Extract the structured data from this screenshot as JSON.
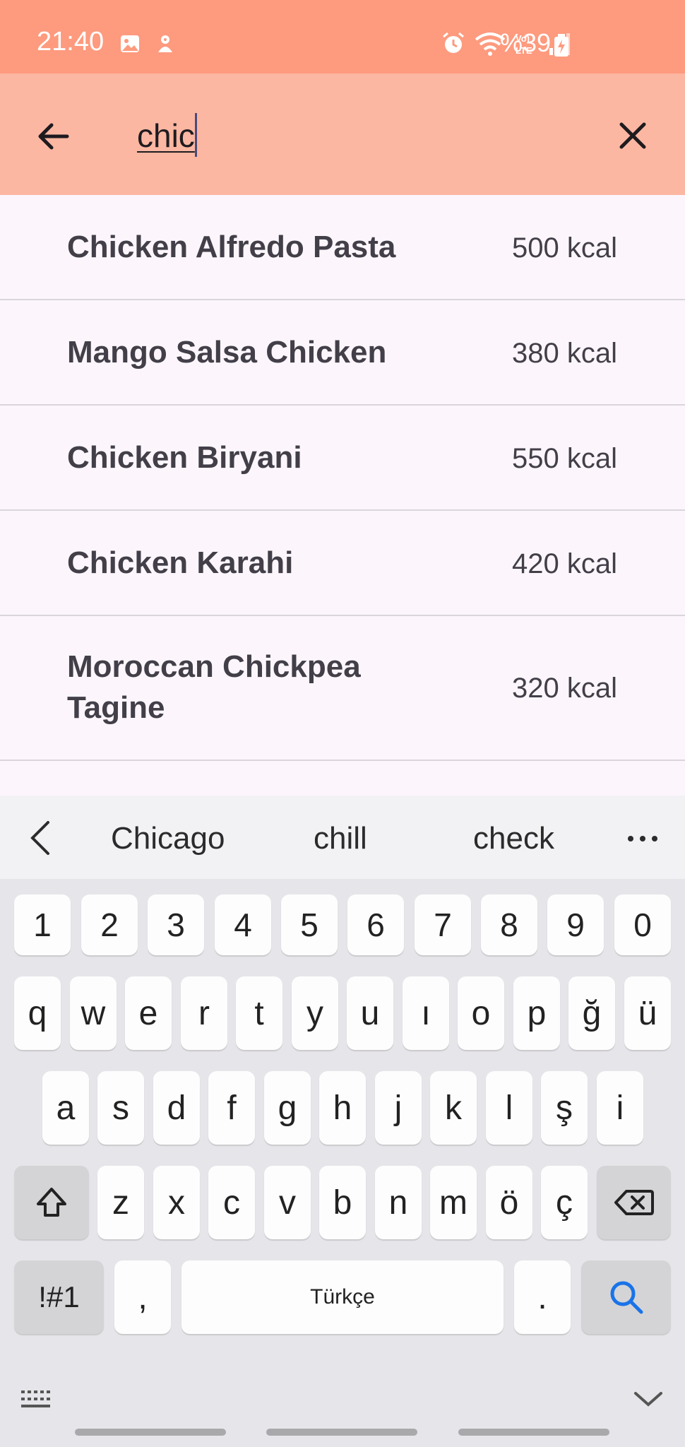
{
  "status_bar": {
    "time": "21:40",
    "battery": "%39",
    "icons": [
      "image-icon",
      "notification-icon",
      "alarm-icon",
      "wifi-icon",
      "volte-icon",
      "signal-icon",
      "battery-charging-icon"
    ]
  },
  "search": {
    "query": "chic",
    "back_icon": "arrow-left-icon",
    "clear_icon": "close-icon"
  },
  "results": [
    {
      "name": "Chicken Alfredo Pasta",
      "kcal": "500 kcal"
    },
    {
      "name": "Mango Salsa Chicken",
      "kcal": "380 kcal"
    },
    {
      "name": "Chicken Biryani",
      "kcal": "550 kcal"
    },
    {
      "name": "Chicken Karahi",
      "kcal": "420 kcal"
    },
    {
      "name": "Moroccan Chickpea Tagine",
      "kcal": "320 kcal"
    }
  ],
  "keyboard": {
    "suggestions": [
      "Chicago",
      "chill",
      "check"
    ],
    "row_numbers": [
      "1",
      "2",
      "3",
      "4",
      "5",
      "6",
      "7",
      "8",
      "9",
      "0"
    ],
    "row1": [
      "q",
      "w",
      "e",
      "r",
      "t",
      "y",
      "u",
      "ı",
      "o",
      "p",
      "ğ",
      "ü"
    ],
    "row2": [
      "a",
      "s",
      "d",
      "f",
      "g",
      "h",
      "j",
      "k",
      "l",
      "ş",
      "i"
    ],
    "row3": [
      "z",
      "x",
      "c",
      "v",
      "b",
      "n",
      "m",
      "ö",
      "ç"
    ],
    "symbols_label": "!#1",
    "comma": ",",
    "space_label": "Türkçe",
    "period": ".",
    "accent_color": "#1a73e8"
  }
}
